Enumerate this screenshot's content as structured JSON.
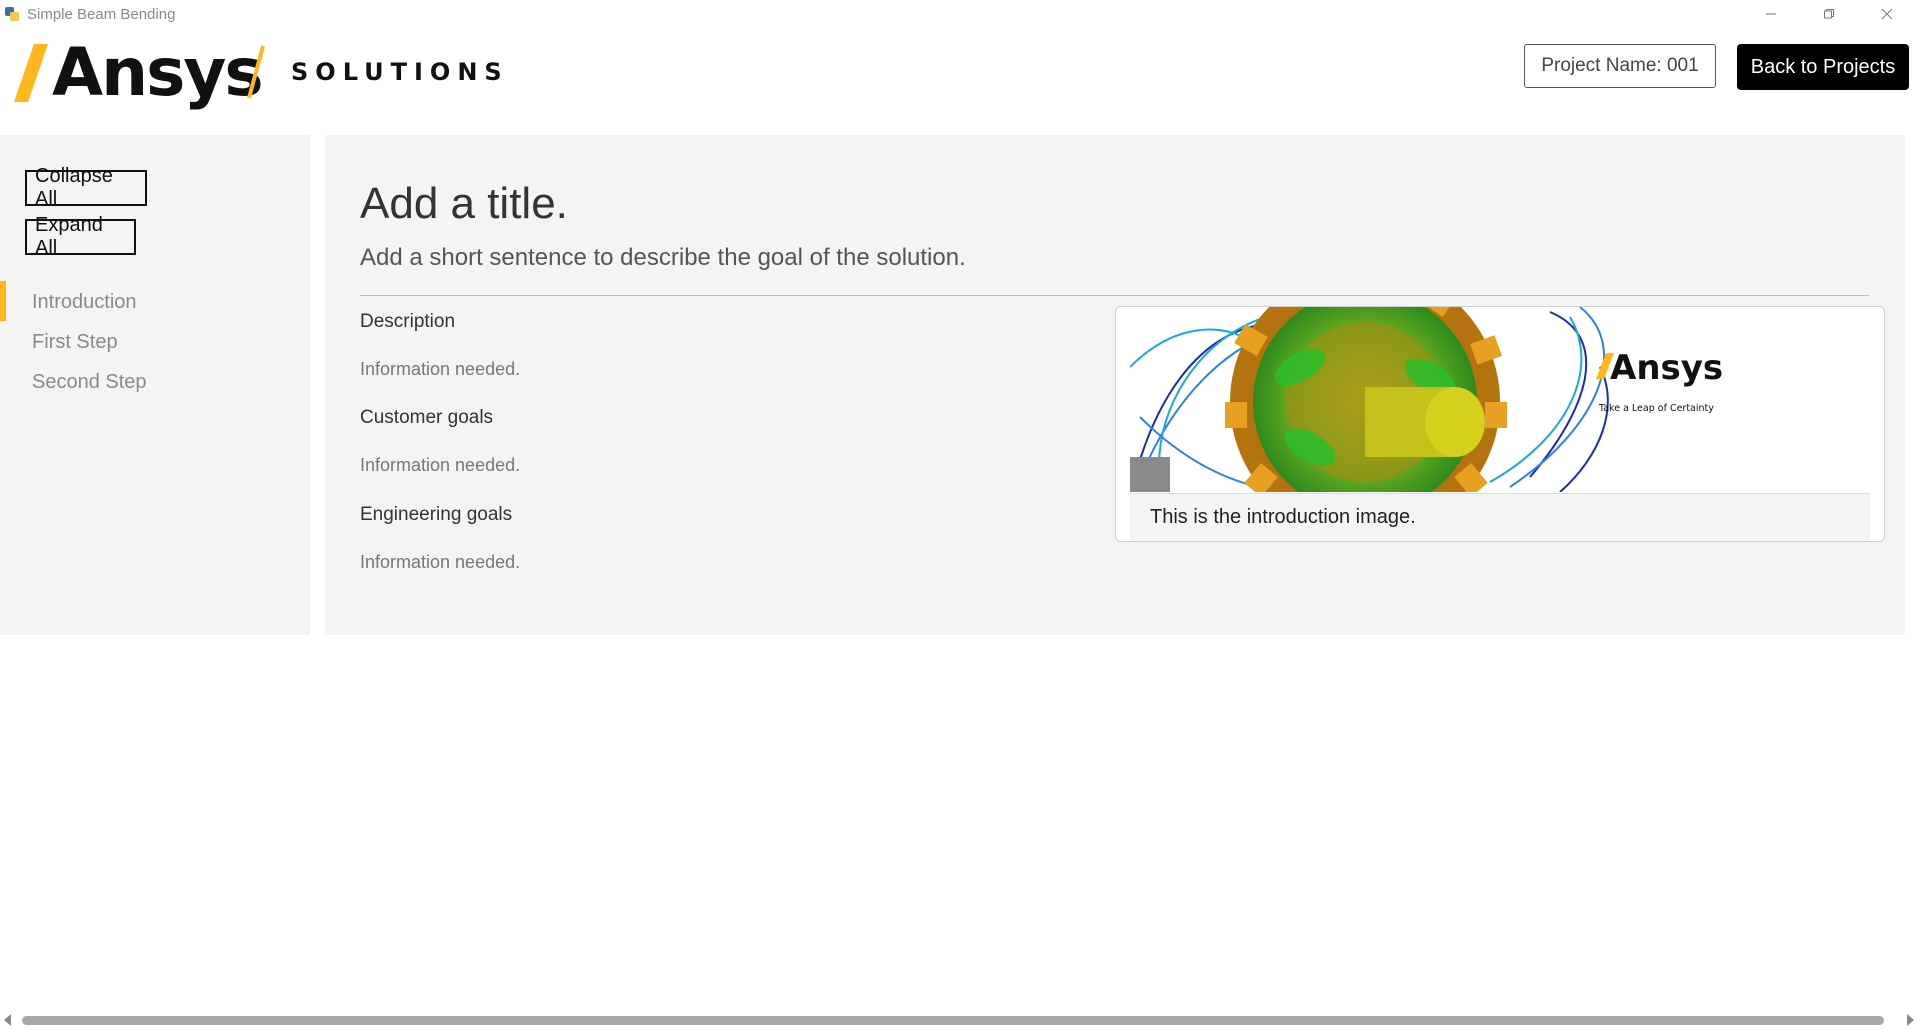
{
  "window": {
    "title": "Simple Beam Bending",
    "icon": "python-icon",
    "controls": [
      "minimize-icon",
      "restore-icon",
      "close-icon"
    ]
  },
  "header": {
    "logo_text": "Ansys",
    "section": "SOLUTIONS",
    "project_name": "Project Name: 001",
    "back_button": "Back to Projects",
    "accent_color": "#ffb71b"
  },
  "sidebar": {
    "collapse_all": "Collapse All",
    "expand_all": "Expand All",
    "items": [
      {
        "label": "Introduction",
        "active": true
      },
      {
        "label": "First Step",
        "active": false
      },
      {
        "label": "Second Step",
        "active": false
      }
    ]
  },
  "main": {
    "title": "Add a title.",
    "subtitle": "Add a short sentence to describe the goal of the solution.",
    "sections": [
      {
        "heading": "Description",
        "text": "Information needed."
      },
      {
        "heading": "Customer goals",
        "text": "Information needed."
      },
      {
        "heading": "Engineering goals",
        "text": "Information needed."
      }
    ],
    "image": {
      "brand": "Ansys",
      "tagline": "Take a Leap of Certainty",
      "caption": "This is the introduction image."
    }
  }
}
